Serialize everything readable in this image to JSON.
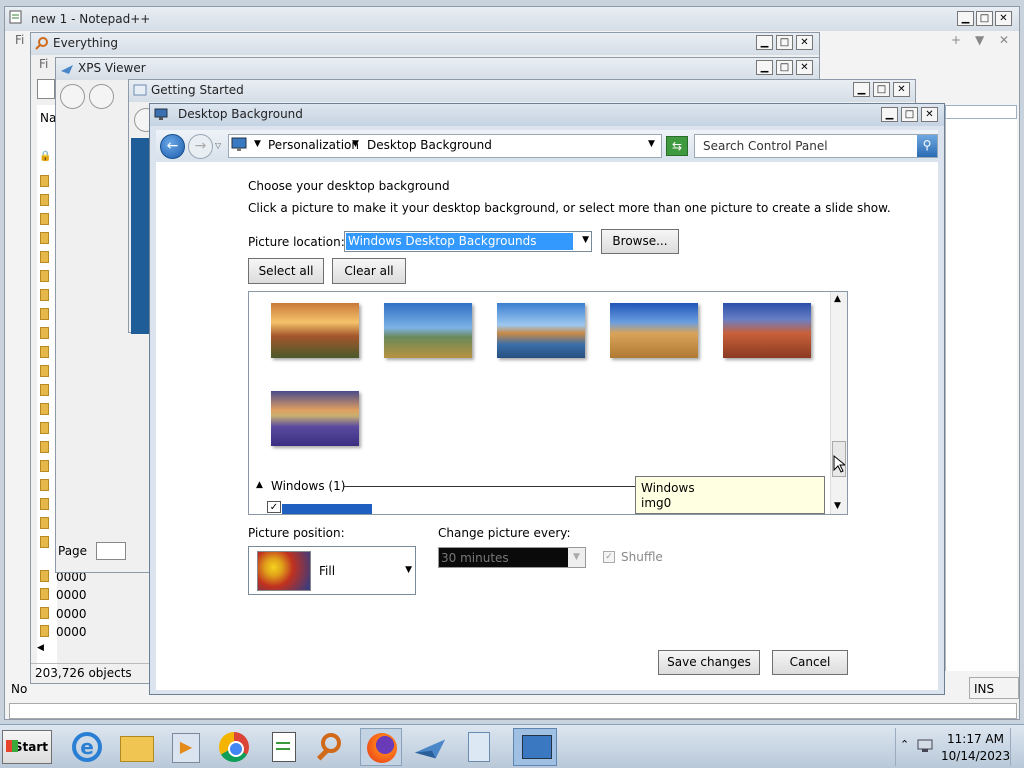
{
  "notepad": {
    "title": "new 1 - Notepad++",
    "menu_char": "Fi",
    "status_left": "No",
    "status_right": "INS"
  },
  "everything": {
    "title": "Everything",
    "menu_char": "Fi",
    "column_char": "Na",
    "status": "203,726 objects",
    "rows": [
      "0000",
      "0000",
      "0000",
      "0000"
    ]
  },
  "xps": {
    "title": "XPS Viewer",
    "page_label": "Page"
  },
  "getting_started": {
    "title": "Getting Started"
  },
  "desktop_bg": {
    "title": "Desktop Background",
    "breadcrumb": [
      "Personalization",
      "Desktop Background"
    ],
    "search_placeholder": "Search Control Panel",
    "heading": "Choose your desktop background",
    "subtext": "Click a picture to make it your desktop background, or select more than one picture to create a slide show.",
    "location_label": "Picture location:",
    "location_value": "Windows Desktop Backgrounds",
    "browse": "Browse...",
    "select_all": "Select all",
    "clear_all": "Clear all",
    "group_label": "Windows (1)",
    "tooltip_line1": "Windows",
    "tooltip_line2": "img0",
    "position_label": "Picture position:",
    "position_value": "Fill",
    "change_label": "Change picture every:",
    "change_value": "30 minutes",
    "shuffle": "Shuffle",
    "save": "Save changes",
    "cancel": "Cancel"
  },
  "taskbar": {
    "start": "Start",
    "time": "11:17 AM",
    "date": "10/14/2023",
    "items": [
      "internet-explorer-icon",
      "file-explorer-icon",
      "media-player-icon",
      "chrome-icon",
      "notepad-plus-icon",
      "everything-search-icon",
      "firefox-icon",
      "xps-viewer-icon",
      "getting-started-icon",
      "control-panel-icon"
    ]
  }
}
